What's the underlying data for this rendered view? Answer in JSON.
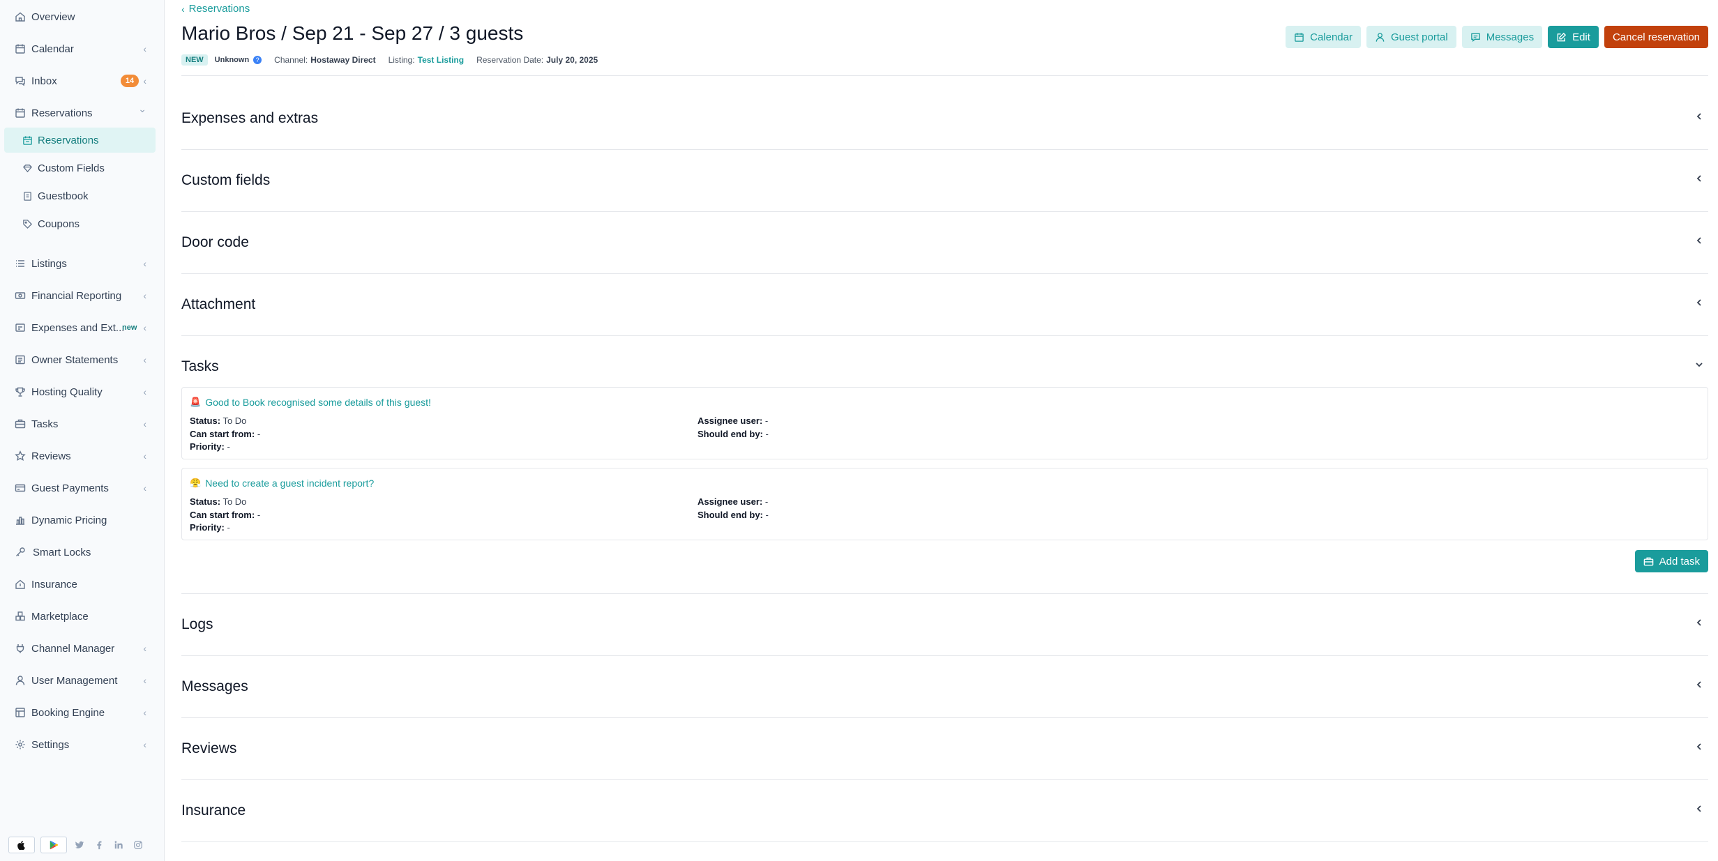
{
  "sidebar": {
    "items": [
      {
        "label": "Overview",
        "icon": "home-icon",
        "chevron": ""
      },
      {
        "label": "Calendar",
        "icon": "calendar-icon",
        "chevron": "‹"
      },
      {
        "label": "Inbox",
        "icon": "chat-icon",
        "chevron": "‹",
        "badge": "14"
      },
      {
        "label": "Reservations",
        "icon": "calendar-check-icon",
        "chevron": "⌄"
      },
      {
        "label": "Reservations",
        "icon": "calendar-check-icon",
        "chevron": "",
        "sub": true,
        "active": true
      },
      {
        "label": "Custom Fields",
        "icon": "diamond-icon",
        "chevron": "",
        "sub": true
      },
      {
        "label": "Guestbook",
        "icon": "book-icon",
        "chevron": "",
        "sub": true
      },
      {
        "label": "Coupons",
        "icon": "tag-icon",
        "chevron": "",
        "sub": true
      },
      {
        "label": "Listings",
        "icon": "list-icon",
        "chevron": "‹"
      },
      {
        "label": "Financial Reporting",
        "icon": "money-icon",
        "chevron": "‹"
      },
      {
        "label": "Expenses and Ext...",
        "icon": "receipt-icon",
        "chevron": "‹",
        "new": "new"
      },
      {
        "label": "Owner Statements",
        "icon": "statement-icon",
        "chevron": "‹"
      },
      {
        "label": "Hosting Quality",
        "icon": "trophy-icon",
        "chevron": "‹"
      },
      {
        "label": "Tasks",
        "icon": "briefcase-icon",
        "chevron": "‹"
      },
      {
        "label": "Reviews",
        "icon": "star-icon",
        "chevron": "‹"
      },
      {
        "label": "Guest Payments",
        "icon": "credit-card-icon",
        "chevron": "‹"
      },
      {
        "label": "Dynamic Pricing",
        "icon": "bar-chart-icon",
        "chevron": ""
      },
      {
        "label": "Smart Locks",
        "icon": "key-icon",
        "chevron": ""
      },
      {
        "label": "Insurance",
        "icon": "house-shield-icon",
        "chevron": ""
      },
      {
        "label": "Marketplace",
        "icon": "puzzle-icon",
        "chevron": ""
      },
      {
        "label": "Channel Manager",
        "icon": "plug-icon",
        "chevron": "‹"
      },
      {
        "label": "User Management",
        "icon": "user-icon",
        "chevron": "‹"
      },
      {
        "label": "Booking Engine",
        "icon": "layout-icon",
        "chevron": "‹"
      },
      {
        "label": "Settings",
        "icon": "gear-icon",
        "chevron": "‹"
      }
    ]
  },
  "header": {
    "breadcrumb": "Reservations",
    "title": "Mario Bros / Sep 21 - Sep 27 / 3 guests",
    "status_pill": "NEW",
    "status_text": "Unknown",
    "channel_label": "Channel:",
    "channel_value": "Hostaway Direct",
    "listing_label": "Listing:",
    "listing_value": "Test Listing",
    "date_label": "Reservation Date:",
    "date_value": "July 20, 2025"
  },
  "actions": {
    "calendar": "Calendar",
    "guest_portal": "Guest portal",
    "messages": "Messages",
    "edit": "Edit",
    "cancel": "Cancel reservation"
  },
  "sections": {
    "expenses": "Expenses and extras",
    "custom_fields": "Custom fields",
    "door_code": "Door code",
    "attachment": "Attachment",
    "tasks": "Tasks",
    "logs": "Logs",
    "messages": "Messages",
    "reviews": "Reviews",
    "insurance": "Insurance"
  },
  "tasks": [
    {
      "emoji": "🚨",
      "title": "Good to Book recognised some details of this guest!",
      "status_label": "Status:",
      "status": "To Do",
      "start_label": "Can start from:",
      "start": "-",
      "priority_label": "Priority:",
      "priority": "-",
      "assignee_label": "Assignee user:",
      "assignee": "-",
      "end_label": "Should end by:",
      "end": "-"
    },
    {
      "emoji": "😤",
      "title": "Need to create a guest incident report?",
      "status_label": "Status:",
      "status": "To Do",
      "start_label": "Can start from:",
      "start": "-",
      "priority_label": "Priority:",
      "priority": "-",
      "assignee_label": "Assignee user:",
      "assignee": "-",
      "end_label": "Should end by:",
      "end": "-"
    }
  ],
  "add_task": "Add task",
  "colors": {
    "accent": "#1a9c9c",
    "accent_light": "#d8f1f1",
    "danger": "#c2410c",
    "badge": "#f28c38"
  }
}
